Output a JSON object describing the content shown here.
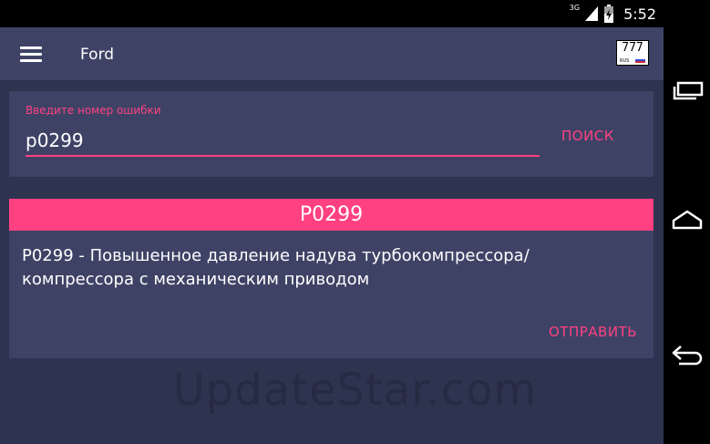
{
  "status_bar": {
    "network": "3G",
    "time": "5:52"
  },
  "app_bar": {
    "title": "Ford",
    "menu_icon": "hamburger-menu-icon",
    "plate": {
      "number": "777",
      "region": "RUS"
    }
  },
  "search": {
    "label": "Введите номер ошибки",
    "value": "p0299",
    "button_label": "ПОИСК"
  },
  "result": {
    "code": "P0299",
    "description": "P0299 - Повышенное давление надува турбокомпрессора/компрессора с механическим приводом",
    "send_label": "ОТПРАВИТЬ"
  },
  "watermark": "UpdateStar.com",
  "colors": {
    "accent": "#ff4081",
    "card": "#3e4366",
    "background": "#2e3350"
  },
  "nav": {
    "recents_icon": "recent-apps-icon",
    "home_icon": "home-icon",
    "back_icon": "back-icon"
  }
}
